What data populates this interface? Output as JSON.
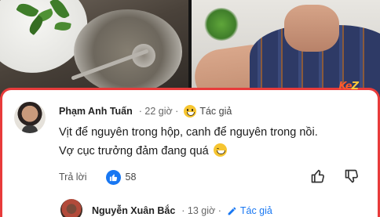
{
  "comment": {
    "name": "Phạm Anh Tuấn",
    "time": "· 22 giờ ·",
    "author_badge": "Tác giả",
    "line1": "Vịt để nguyên trong hộp, canh để nguyên trong nồi.",
    "line2": "Vợ cục trưởng đảm đang quá",
    "reply_label": "Trả lời",
    "like_count": "58"
  },
  "reply": {
    "name": "Nguyễn Xuân Bắc",
    "time": "· 13 giờ ·",
    "author_badge": "Tác giả"
  },
  "watermark": {
    "text_a": "Ke",
    "text_b": "Z"
  },
  "colors": {
    "card_border": "#e83b3b",
    "like_blue": "#1877f2",
    "author_blue": "#1877f2"
  },
  "icons": [
    "grin-emoji-icon",
    "smile-emoji-icon",
    "like-icon",
    "thumb-up-icon",
    "thumb-down-icon",
    "pencil-icon"
  ]
}
